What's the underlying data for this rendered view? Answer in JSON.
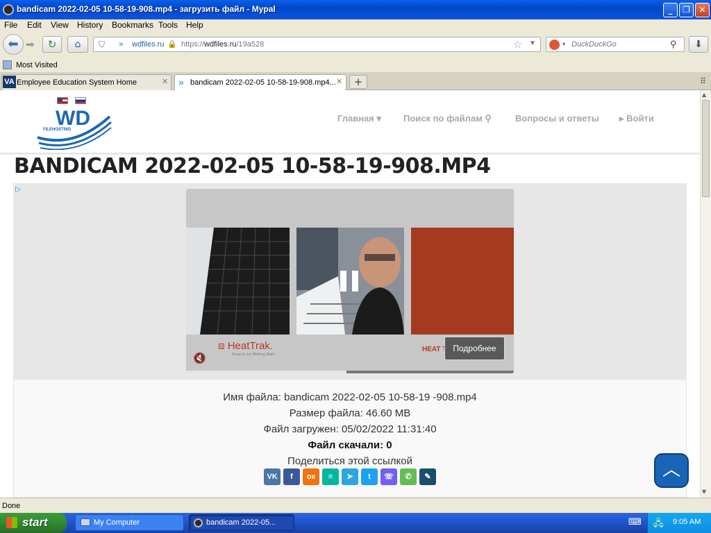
{
  "window": {
    "title": "bandicam 2022-02-05 10-58-19-908.mp4 - загрузить файл - Mypal"
  },
  "menu": [
    "File",
    "Edit",
    "View",
    "History",
    "Bookmarks",
    "Tools",
    "Help"
  ],
  "urlbar": {
    "identity": "wdfiles.ru",
    "url_prefix": "https://",
    "url_host": "wdfiles.ru",
    "url_path": "/19a528"
  },
  "search": {
    "placeholder": "DuckDuckGo"
  },
  "bookmarks": {
    "most_visited": "Most Visited"
  },
  "tabs": [
    {
      "icon": "VA",
      "label": "Employee Education System Home"
    },
    {
      "label": "bandicam 2022-02-05 10-58-19-908.mp4..."
    }
  ],
  "site": {
    "logo_text": "WD",
    "logo_sub": "FILEHOSTING",
    "nav": [
      "Главная ▾",
      "Поиск по файлам",
      "Вопросы и ответы",
      "Войти"
    ]
  },
  "page": {
    "title": "BANDICAM 2022-02-05 10-58-19-908.MP4"
  },
  "ad": {
    "brand": "HeatTrak.",
    "brand_tagline": "Snow & Ice Melting Mats",
    "brand_right": "HEAT TRAK",
    "cta": "Подробнее",
    "progress": 0.49
  },
  "file": {
    "name_line": "Имя файла: bandicam 2022-02-05 10-58-19 -908.mp4",
    "size_line": "Размер файла: 46.60 MB",
    "uploaded_line": "Файл загружен: 05/02/2022 11:31:40",
    "downloads_line": "Файл скачали: 0",
    "share_line": "Поделиться этой ссылкой"
  },
  "share_buttons": [
    {
      "name": "vk",
      "label": "VK",
      "color": "#4a76a8"
    },
    {
      "name": "facebook",
      "label": "f",
      "color": "#3b5998"
    },
    {
      "name": "odnoklassniki",
      "label": "ок",
      "color": "#f2720c"
    },
    {
      "name": "sms",
      "label": "≡",
      "color": "#00b8a0"
    },
    {
      "name": "telegram",
      "label": "➤",
      "color": "#2ca5e0"
    },
    {
      "name": "twitter",
      "label": "t",
      "color": "#1da1f2"
    },
    {
      "name": "viber",
      "label": "☏",
      "color": "#7360f2"
    },
    {
      "name": "whatsapp",
      "label": "✆",
      "color": "#65bc54"
    },
    {
      "name": "livejournal",
      "label": "✎",
      "color": "#1b4e6b"
    }
  ],
  "status": {
    "text": "Done"
  },
  "taskbar": {
    "start": "start",
    "items": [
      "My Computer",
      "bandicam 2022-05..."
    ],
    "clock": "9:05 AM"
  }
}
